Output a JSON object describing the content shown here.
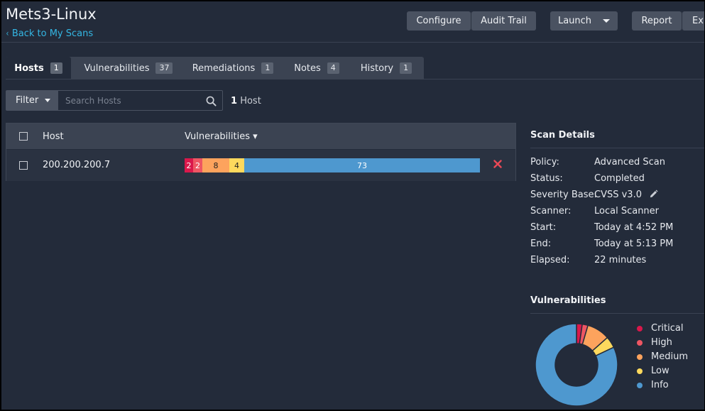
{
  "header": {
    "title": "Mets3-Linux",
    "back_link": "Back to My Scans",
    "buttons": {
      "configure": "Configure",
      "audit_trail": "Audit Trail",
      "launch": "Launch",
      "report": "Report",
      "export": "Ex"
    }
  },
  "tabs": [
    {
      "label": "Hosts",
      "count": "1",
      "active": true
    },
    {
      "label": "Vulnerabilities",
      "count": "37"
    },
    {
      "label": "Remediations",
      "count": "1"
    },
    {
      "label": "Notes",
      "count": "4"
    },
    {
      "label": "History",
      "count": "1"
    }
  ],
  "filter": {
    "label": "Filter",
    "search_placeholder": "Search Hosts",
    "count_number": "1",
    "count_label": "Host"
  },
  "table": {
    "columns": {
      "host": "Host",
      "vulnerabilities": "Vulnerabilities ▾"
    },
    "rows": [
      {
        "host": "200.200.200.7",
        "severity_counts": {
          "critical": "2",
          "high": "2",
          "medium": "8",
          "low": "4",
          "info": "73"
        }
      }
    ]
  },
  "scan_details": {
    "title": "Scan Details",
    "items": [
      {
        "label": "Policy:",
        "value": "Advanced Scan"
      },
      {
        "label": "Status:",
        "value": "Completed"
      },
      {
        "label": "Severity Base:",
        "value": "CVSS v3.0"
      },
      {
        "label": "Scanner:",
        "value": "Local Scanner"
      },
      {
        "label": "Start:",
        "value": "Today at 4:52 PM"
      },
      {
        "label": "End:",
        "value": "Today at 5:13 PM"
      },
      {
        "label": "Elapsed:",
        "value": "22 minutes"
      }
    ]
  },
  "vulnerabilities_panel": {
    "title": "Vulnerabilities",
    "legend": [
      "Critical",
      "High",
      "Medium",
      "Low",
      "Info"
    ]
  },
  "chart_data": {
    "type": "pie",
    "categories": [
      "Critical",
      "High",
      "Medium",
      "Low",
      "Info"
    ],
    "values": [
      2,
      2,
      8,
      4,
      73
    ],
    "colors": [
      "#d9184b",
      "#ee5663",
      "#fda35d",
      "#fdd95d",
      "#4e98cf"
    ]
  },
  "colors": {
    "critical": "#d9184b",
    "high": "#ee5663",
    "medium": "#fda35d",
    "low": "#fdd95d",
    "info": "#4e98cf",
    "link": "#34b6e3",
    "remove": "#e94856"
  },
  "icons": {
    "back": "chevron-left-icon",
    "search": "search-icon",
    "remove": "close-icon",
    "edit": "pencil-icon",
    "dropdown": "caret-down-icon"
  }
}
